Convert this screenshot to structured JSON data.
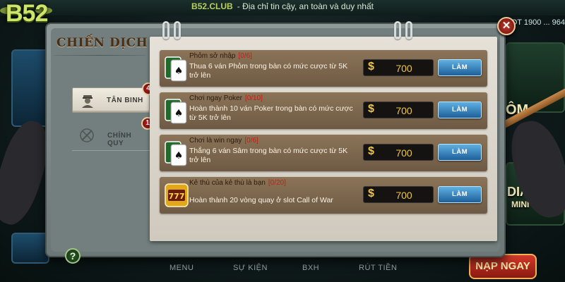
{
  "top_bar": {
    "site": "B52.CLUB",
    "tagline": "- Địa chỉ tin cậy, an toàn và duy nhất"
  },
  "background": {
    "logo": "B52",
    "phone_partial": "OT 1900 ... 964",
    "nav": [
      "MENU",
      "SỰ KIỆN",
      "BXH",
      "RÚT TIỀN"
    ],
    "nap_ngay": "NẠP NGAY"
  },
  "dialog": {
    "title": "CHIẾN DỊCH",
    "close_label": "✕",
    "help_label": "?",
    "tabs": [
      {
        "label": "TÂN BINH",
        "badge": "4",
        "icon": "soldier-icon",
        "active": true
      },
      {
        "label": "CHÍNH QUY",
        "badge": "1",
        "icon": "crossed-rifles-icon",
        "active": false
      }
    ],
    "missions": [
      {
        "title": "Phỏm sở nhập",
        "progress": "[0/6]",
        "description": "Thua 6 ván Phỏm trong bàn có mức cược từ 5K trở lên",
        "reward_symbol": "$",
        "reward": "700",
        "button": "LÀM",
        "icon": "cards-icon"
      },
      {
        "title": "Chơi ngay Poker",
        "progress": "[0/10]",
        "description": "Hoàn thành 10 ván Poker trong bàn có mức cược từ 5K trở lên",
        "reward_symbol": "$",
        "reward": "700",
        "button": "LÀM",
        "icon": "cards-icon"
      },
      {
        "title": "Chơi là win ngay",
        "progress": "[0/6]",
        "description": "Thắng 6 ván Sâm trong bàn có mức cược từ 5K trở lên",
        "reward_symbol": "$",
        "reward": "700",
        "button": "LÀM",
        "icon": "cards-icon"
      },
      {
        "title": "Kẻ thù của kẻ thù là bạn",
        "progress": "[0/20]",
        "description": "Hoàn thành 20 vòng quay ở slot Call of War",
        "reward_symbol": "$",
        "reward": "700",
        "button": "LÀM",
        "icon": "slot-777-icon"
      }
    ]
  },
  "colors": {
    "progress_red": "#c41d12",
    "reward_gold": "#f3c63a",
    "button_blue": "#1d5f9a"
  }
}
